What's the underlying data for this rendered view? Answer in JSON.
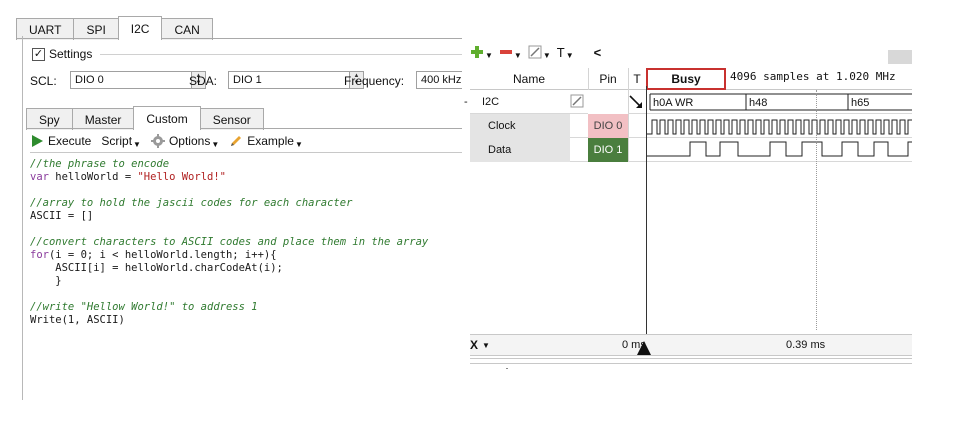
{
  "top_tabs": [
    "UART",
    "SPI",
    "I2C",
    "CAN"
  ],
  "active_top_tab": "I2C",
  "settings": {
    "title": "Settings",
    "checked": true,
    "scl_label": "SCL:",
    "scl_value": "DIO 0",
    "sda_label": "SDA:",
    "sda_value": "DIO 1",
    "frequency_label": "Frequency:",
    "frequency_value": "400 kHz"
  },
  "sub_tabs": [
    "Spy",
    "Master",
    "Custom",
    "Sensor"
  ],
  "active_sub_tab": "Custom",
  "toolbar": {
    "execute": "Execute",
    "script": "Script",
    "options": "Options",
    "example": "Example"
  },
  "code": [
    [
      {
        "c": "cm",
        "t": "//the phrase to encode"
      }
    ],
    [
      {
        "c": "kw",
        "t": "var"
      },
      {
        "c": "pl",
        "t": " helloWorld = "
      },
      {
        "c": "st",
        "t": "\"Hello World!\""
      }
    ],
    [],
    [
      {
        "c": "cm",
        "t": "//array to hold the jascii codes for each character"
      }
    ],
    [
      {
        "c": "pl",
        "t": "ASCII = []"
      }
    ],
    [],
    [
      {
        "c": "cm",
        "t": "//convert characters to ASCII codes and place them in the array"
      }
    ],
    [
      {
        "c": "kw",
        "t": "for"
      },
      {
        "c": "pl",
        "t": "(i = 0; i < helloWorld.length; i++){"
      }
    ],
    [
      {
        "c": "pl",
        "t": "    ASCII[i] = helloWorld.charCodeAt(i);"
      }
    ],
    [
      {
        "c": "pl",
        "t": "    }"
      }
    ],
    [],
    [
      {
        "c": "cm",
        "t": "//write \"Hellow World!\" to address 1"
      }
    ],
    [
      {
        "c": "pl",
        "t": "Write(1, ASCII)"
      }
    ]
  ],
  "analyzer": {
    "toolbar_t": "T",
    "toolbar_back": "<",
    "col_name": "Name",
    "col_pin": "Pin",
    "col_t": "T",
    "busy": "Busy",
    "samples": "4096 samples at 1.020 MHz",
    "rows": [
      {
        "name": "I2C",
        "expander": "-",
        "pin": ""
      },
      {
        "name": "Clock",
        "pin": "DIO 0"
      },
      {
        "name": "Data",
        "pin": "DIO 1"
      }
    ],
    "i2c_labels": [
      "h0A WR",
      "h48",
      "h65"
    ],
    "x_label": "X",
    "time_zero": "0 ms",
    "time_mid": "0.39 ms"
  }
}
